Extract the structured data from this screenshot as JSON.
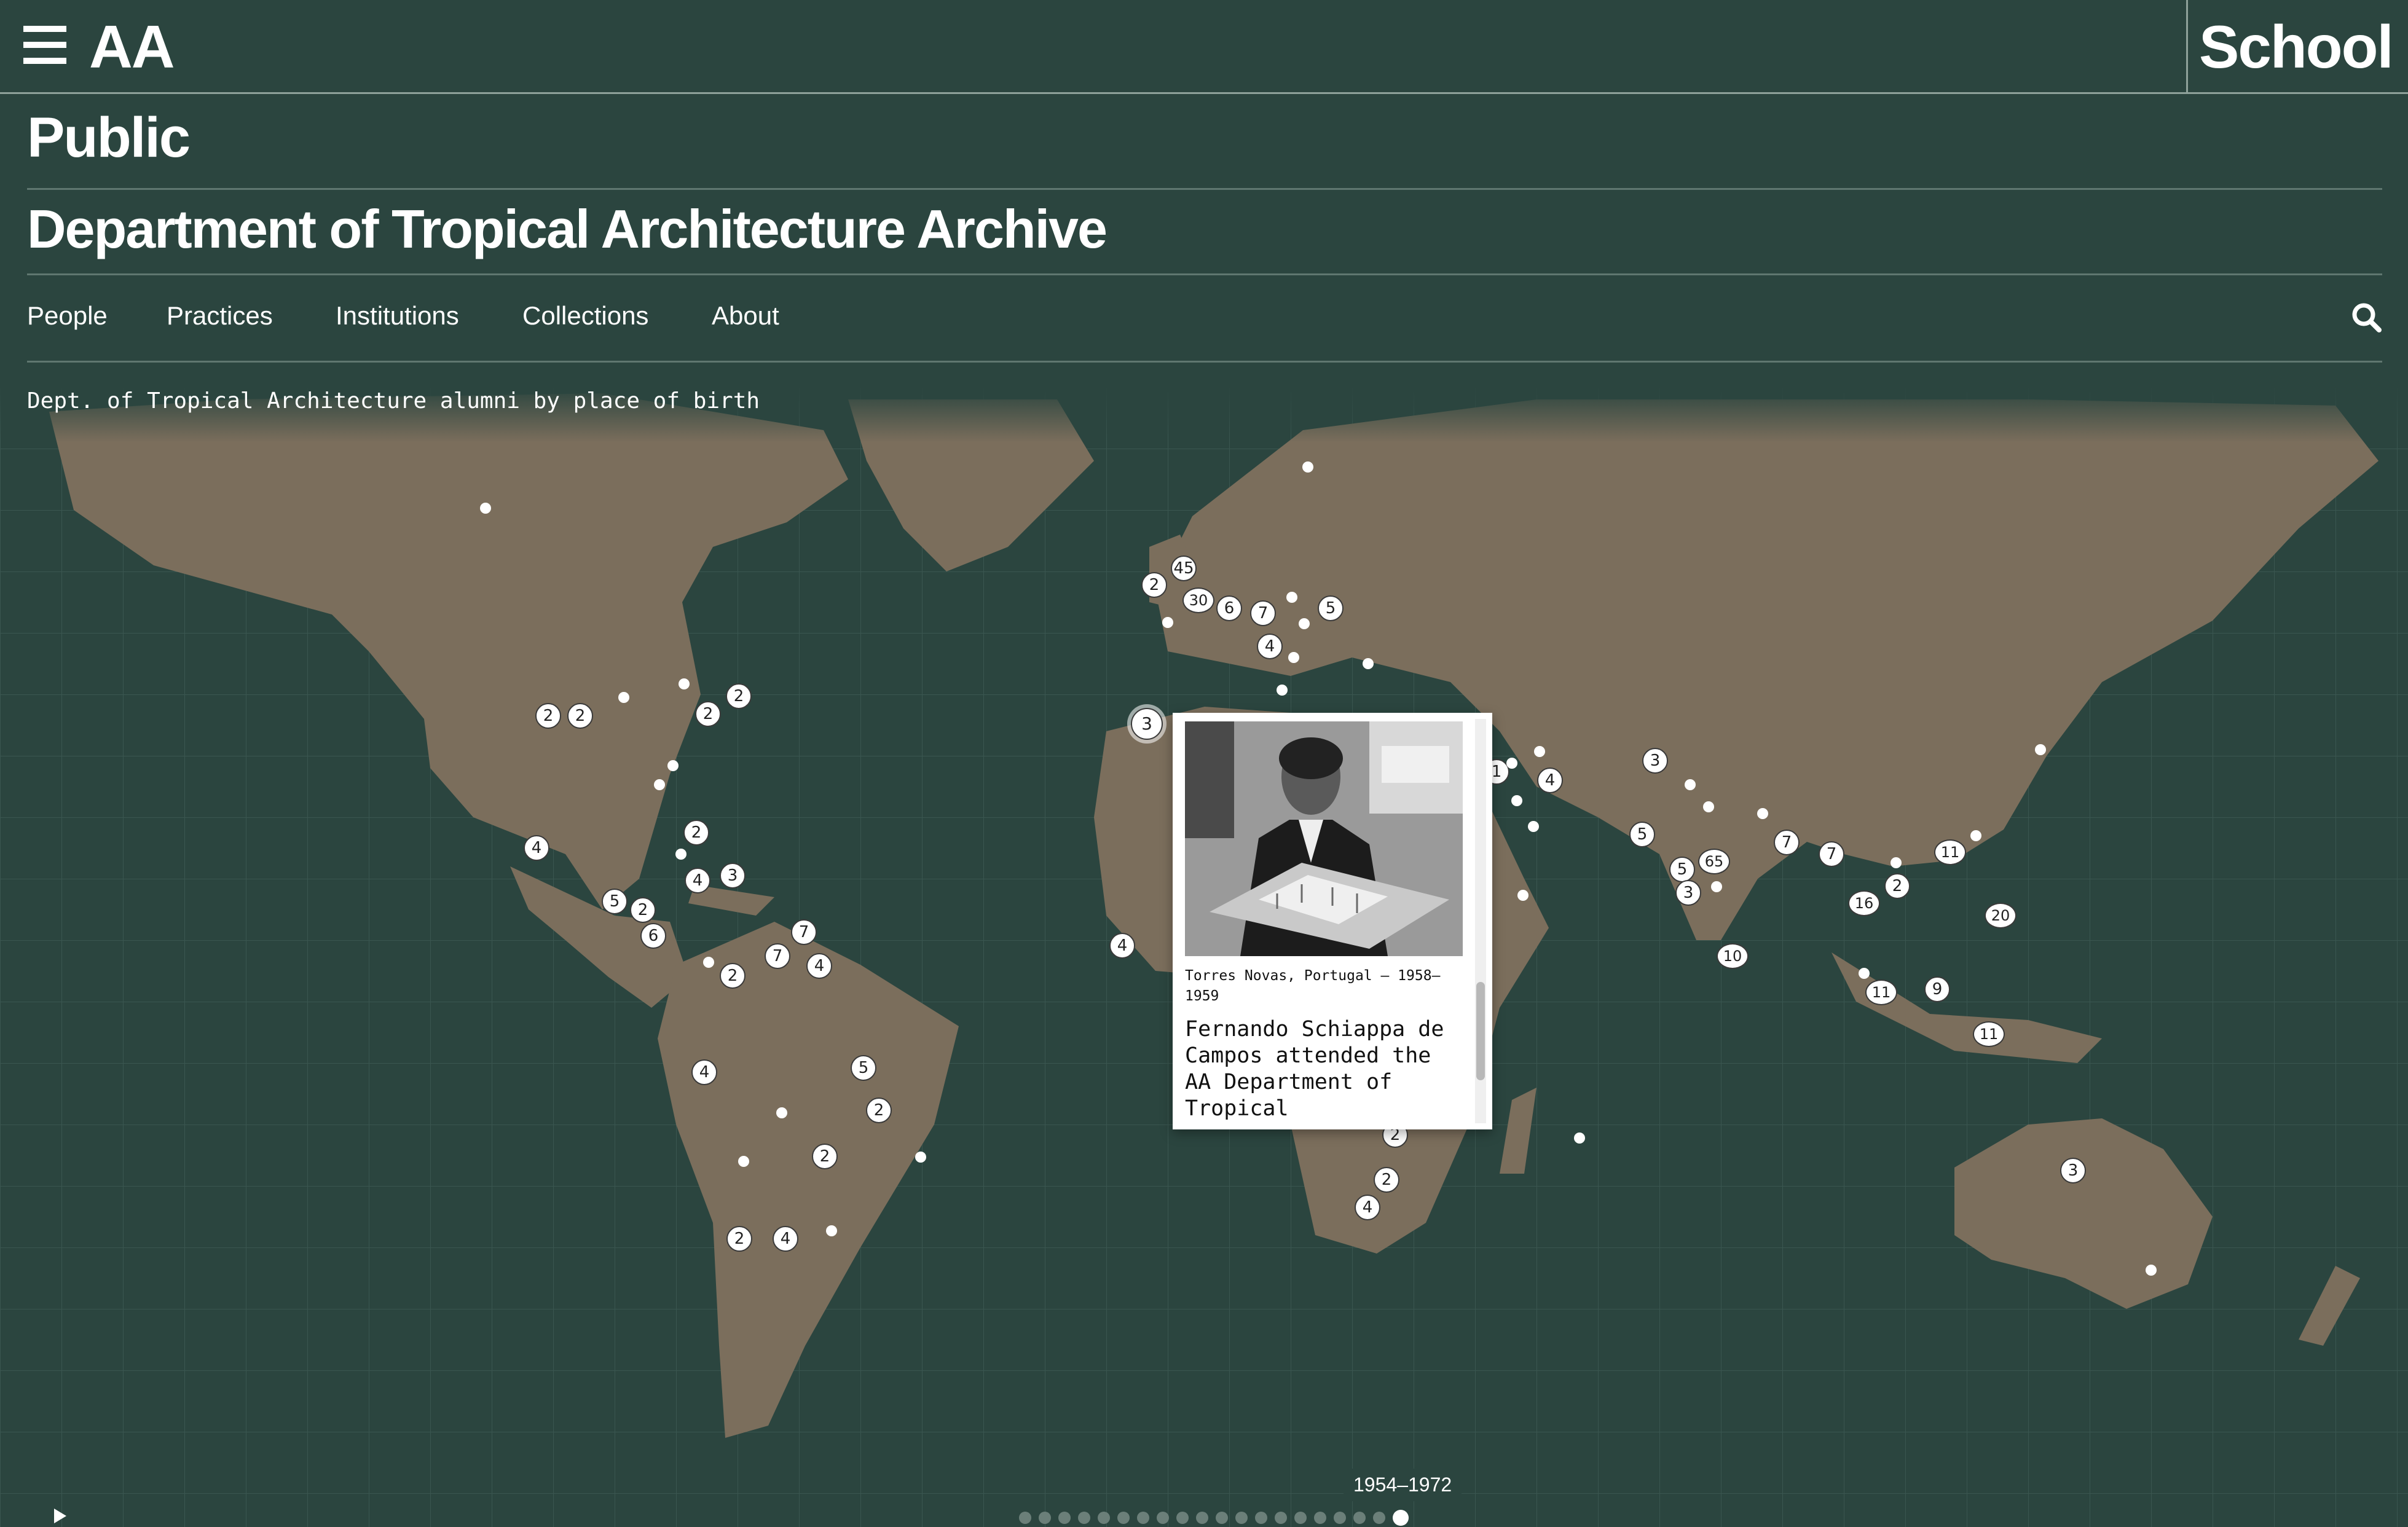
{
  "header": {
    "menu_icon": "hamburger-icon",
    "logo": "AA",
    "school_link": "School"
  },
  "section_title": "Public",
  "page_title": "Department of Tropical Architecture Archive",
  "nav": {
    "items": [
      {
        "label": "People"
      },
      {
        "label": "Practices"
      },
      {
        "label": "Institutions"
      },
      {
        "label": "Collections"
      },
      {
        "label": "About"
      }
    ],
    "search_icon": "search-icon"
  },
  "map": {
    "caption": "Dept. of Tropical Architecture alumni by place of birth",
    "land_color": "#7b6e5c",
    "sea_color": "#2b453f",
    "markers": [
      {
        "label": ""
      },
      {
        "label": "45"
      },
      {
        "label": "2"
      },
      {
        "label": "30"
      },
      {
        "label": "6"
      },
      {
        "label": "7"
      },
      {
        "label": ""
      },
      {
        "label": "5"
      },
      {
        "label": ""
      },
      {
        "label": "4"
      },
      {
        "label": ""
      },
      {
        "label": ""
      },
      {
        "label": ""
      },
      {
        "label": ""
      },
      {
        "label": "3"
      },
      {
        "label": "2"
      },
      {
        "label": "2"
      },
      {
        "label": ""
      },
      {
        "label": ""
      },
      {
        "label": "2"
      },
      {
        "label": "2"
      },
      {
        "label": ""
      },
      {
        "label": ""
      },
      {
        "label": "4"
      },
      {
        "label": "2"
      },
      {
        "label": ""
      },
      {
        "label": "4"
      },
      {
        "label": "3"
      },
      {
        "label": "5"
      },
      {
        "label": "2"
      },
      {
        "label": "6"
      },
      {
        "label": "7"
      },
      {
        "label": "7"
      },
      {
        "label": "4"
      },
      {
        "label": ""
      },
      {
        "label": "2"
      },
      {
        "label": "4"
      },
      {
        "label": "5"
      },
      {
        "label": "2"
      },
      {
        "label": ""
      },
      {
        "label": "2"
      },
      {
        "label": ""
      },
      {
        "label": ""
      },
      {
        "label": "2"
      },
      {
        "label": "4"
      },
      {
        "label": ""
      },
      {
        "label": "4"
      },
      {
        "label": "2"
      },
      {
        "label": "2"
      },
      {
        "label": "4"
      },
      {
        "label": ""
      },
      {
        "label": "1"
      },
      {
        "label": ""
      },
      {
        "label": ""
      },
      {
        "label": "4"
      },
      {
        "label": ""
      },
      {
        "label": ""
      },
      {
        "label": ""
      },
      {
        "label": "3"
      },
      {
        "label": ""
      },
      {
        "label": ""
      },
      {
        "label": ""
      },
      {
        "label": "5"
      },
      {
        "label": "5"
      },
      {
        "label": "65"
      },
      {
        "label": "3"
      },
      {
        "label": ""
      },
      {
        "label": "10"
      },
      {
        "label": "7"
      },
      {
        "label": "7"
      },
      {
        "label": ""
      },
      {
        "label": "2"
      },
      {
        "label": "16"
      },
      {
        "label": "11"
      },
      {
        "label": ""
      },
      {
        "label": "20"
      },
      {
        "label": ""
      },
      {
        "label": "11"
      },
      {
        "label": "9"
      },
      {
        "label": "11"
      },
      {
        "label": ""
      },
      {
        "label": "3"
      },
      {
        "label": ""
      }
    ]
  },
  "popup": {
    "place_dates": "Torres Novas, Portugal – 1958–1959",
    "description": "Fernando Schiappa de Campos attended the AA Department of Tropical"
  },
  "timeline": {
    "label": "1954–1972",
    "play_icon": "play-icon",
    "steps": 20,
    "active_step": 20
  }
}
